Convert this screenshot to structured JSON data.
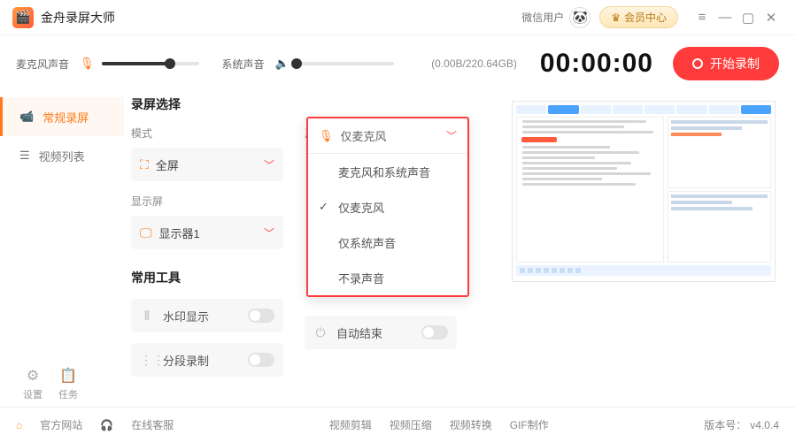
{
  "app": {
    "title": "金舟录屏大师"
  },
  "titlebar": {
    "user_label": "微信用户",
    "vip_label": "会员中心"
  },
  "top": {
    "mic_label": "麦克风声音",
    "mic_level_pct": 70,
    "sys_label": "系统声音",
    "sys_level_pct": 0,
    "storage": "(0.00B/220.64GB)",
    "timer": "00:00:00",
    "record_label": "开始录制"
  },
  "sidebar": {
    "items": [
      {
        "label": "常规录屏",
        "active": true
      },
      {
        "label": "视频列表",
        "active": false
      }
    ],
    "settings": "设置",
    "tasks": "任务"
  },
  "content": {
    "section_title": "录屏选择",
    "mode_label": "模式",
    "mode_value": "全屏",
    "source_label": "声源",
    "source_value": "仅麦克风",
    "source_options": [
      "麦克风和系统声音",
      "仅麦克风",
      "仅系统声音",
      "不录声音"
    ],
    "source_selected_index": 1,
    "display_label": "显示屏",
    "display_value": "显示器1",
    "tools_title": "常用工具",
    "watermark": "水印显示",
    "segment": "分段录制",
    "autoend": "自动结束"
  },
  "footer": {
    "site": "官方网站",
    "support": "在线客服",
    "links": [
      "视频剪辑",
      "视频压缩",
      "视频转换",
      "GIF制作"
    ],
    "version_label": "版本号：",
    "version": "v4.0.4"
  }
}
